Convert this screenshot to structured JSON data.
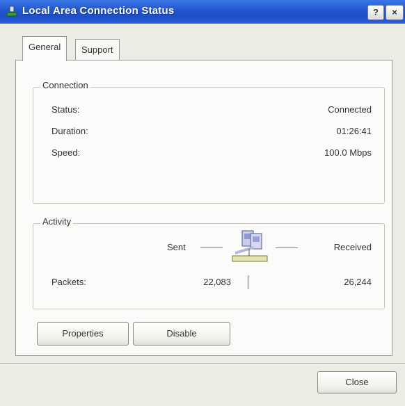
{
  "window": {
    "title": "Local Area Connection Status",
    "help_label": "?",
    "close_label": "×"
  },
  "tabs": [
    {
      "label": "General",
      "active": true
    },
    {
      "label": "Support",
      "active": false
    }
  ],
  "connection": {
    "group_label": "Connection",
    "status_label": "Status:",
    "status_value": "Connected",
    "duration_label": "Duration:",
    "duration_value": "01:26:41",
    "speed_label": "Speed:",
    "speed_value": "100.0 Mbps"
  },
  "activity": {
    "group_label": "Activity",
    "sent_label": "Sent",
    "received_label": "Received",
    "packets_label": "Packets:",
    "packets_sent": "22,083",
    "packets_received": "26,244"
  },
  "buttons": {
    "properties_label": "Properties",
    "disable_label": "Disable",
    "close_label": "Close"
  },
  "icons": {
    "title_icon": "network-connection-icon",
    "activity_icon": "network-activity-icon"
  },
  "colors": {
    "titlebar": "#2457d1",
    "title_text": "#ffffff",
    "dialog_bg": "#ecebe4"
  }
}
